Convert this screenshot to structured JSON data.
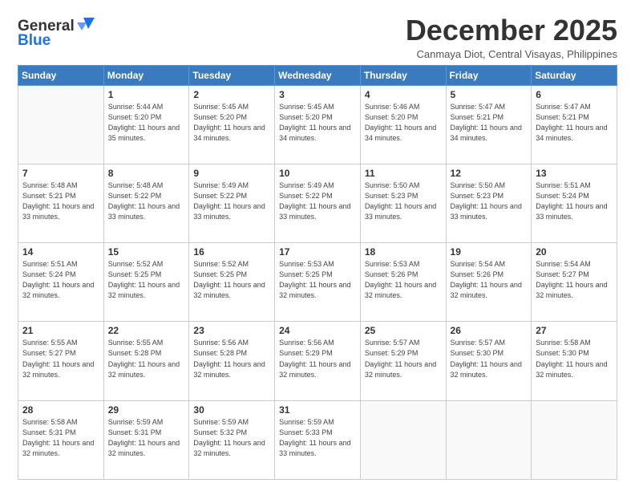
{
  "header": {
    "logo_general": "General",
    "logo_blue": "Blue",
    "month_title": "December 2025",
    "location": "Canmaya Diot, Central Visayas, Philippines"
  },
  "days_of_week": [
    "Sunday",
    "Monday",
    "Tuesday",
    "Wednesday",
    "Thursday",
    "Friday",
    "Saturday"
  ],
  "weeks": [
    [
      {
        "day": "",
        "sunrise": "",
        "sunset": "",
        "daylight": ""
      },
      {
        "day": "1",
        "sunrise": "Sunrise: 5:44 AM",
        "sunset": "Sunset: 5:20 PM",
        "daylight": "Daylight: 11 hours and 35 minutes."
      },
      {
        "day": "2",
        "sunrise": "Sunrise: 5:45 AM",
        "sunset": "Sunset: 5:20 PM",
        "daylight": "Daylight: 11 hours and 34 minutes."
      },
      {
        "day": "3",
        "sunrise": "Sunrise: 5:45 AM",
        "sunset": "Sunset: 5:20 PM",
        "daylight": "Daylight: 11 hours and 34 minutes."
      },
      {
        "day": "4",
        "sunrise": "Sunrise: 5:46 AM",
        "sunset": "Sunset: 5:20 PM",
        "daylight": "Daylight: 11 hours and 34 minutes."
      },
      {
        "day": "5",
        "sunrise": "Sunrise: 5:47 AM",
        "sunset": "Sunset: 5:21 PM",
        "daylight": "Daylight: 11 hours and 34 minutes."
      },
      {
        "day": "6",
        "sunrise": "Sunrise: 5:47 AM",
        "sunset": "Sunset: 5:21 PM",
        "daylight": "Daylight: 11 hours and 34 minutes."
      }
    ],
    [
      {
        "day": "7",
        "sunrise": "Sunrise: 5:48 AM",
        "sunset": "Sunset: 5:21 PM",
        "daylight": "Daylight: 11 hours and 33 minutes."
      },
      {
        "day": "8",
        "sunrise": "Sunrise: 5:48 AM",
        "sunset": "Sunset: 5:22 PM",
        "daylight": "Daylight: 11 hours and 33 minutes."
      },
      {
        "day": "9",
        "sunrise": "Sunrise: 5:49 AM",
        "sunset": "Sunset: 5:22 PM",
        "daylight": "Daylight: 11 hours and 33 minutes."
      },
      {
        "day": "10",
        "sunrise": "Sunrise: 5:49 AM",
        "sunset": "Sunset: 5:22 PM",
        "daylight": "Daylight: 11 hours and 33 minutes."
      },
      {
        "day": "11",
        "sunrise": "Sunrise: 5:50 AM",
        "sunset": "Sunset: 5:23 PM",
        "daylight": "Daylight: 11 hours and 33 minutes."
      },
      {
        "day": "12",
        "sunrise": "Sunrise: 5:50 AM",
        "sunset": "Sunset: 5:23 PM",
        "daylight": "Daylight: 11 hours and 33 minutes."
      },
      {
        "day": "13",
        "sunrise": "Sunrise: 5:51 AM",
        "sunset": "Sunset: 5:24 PM",
        "daylight": "Daylight: 11 hours and 33 minutes."
      }
    ],
    [
      {
        "day": "14",
        "sunrise": "Sunrise: 5:51 AM",
        "sunset": "Sunset: 5:24 PM",
        "daylight": "Daylight: 11 hours and 32 minutes."
      },
      {
        "day": "15",
        "sunrise": "Sunrise: 5:52 AM",
        "sunset": "Sunset: 5:25 PM",
        "daylight": "Daylight: 11 hours and 32 minutes."
      },
      {
        "day": "16",
        "sunrise": "Sunrise: 5:52 AM",
        "sunset": "Sunset: 5:25 PM",
        "daylight": "Daylight: 11 hours and 32 minutes."
      },
      {
        "day": "17",
        "sunrise": "Sunrise: 5:53 AM",
        "sunset": "Sunset: 5:25 PM",
        "daylight": "Daylight: 11 hours and 32 minutes."
      },
      {
        "day": "18",
        "sunrise": "Sunrise: 5:53 AM",
        "sunset": "Sunset: 5:26 PM",
        "daylight": "Daylight: 11 hours and 32 minutes."
      },
      {
        "day": "19",
        "sunrise": "Sunrise: 5:54 AM",
        "sunset": "Sunset: 5:26 PM",
        "daylight": "Daylight: 11 hours and 32 minutes."
      },
      {
        "day": "20",
        "sunrise": "Sunrise: 5:54 AM",
        "sunset": "Sunset: 5:27 PM",
        "daylight": "Daylight: 11 hours and 32 minutes."
      }
    ],
    [
      {
        "day": "21",
        "sunrise": "Sunrise: 5:55 AM",
        "sunset": "Sunset: 5:27 PM",
        "daylight": "Daylight: 11 hours and 32 minutes."
      },
      {
        "day": "22",
        "sunrise": "Sunrise: 5:55 AM",
        "sunset": "Sunset: 5:28 PM",
        "daylight": "Daylight: 11 hours and 32 minutes."
      },
      {
        "day": "23",
        "sunrise": "Sunrise: 5:56 AM",
        "sunset": "Sunset: 5:28 PM",
        "daylight": "Daylight: 11 hours and 32 minutes."
      },
      {
        "day": "24",
        "sunrise": "Sunrise: 5:56 AM",
        "sunset": "Sunset: 5:29 PM",
        "daylight": "Daylight: 11 hours and 32 minutes."
      },
      {
        "day": "25",
        "sunrise": "Sunrise: 5:57 AM",
        "sunset": "Sunset: 5:29 PM",
        "daylight": "Daylight: 11 hours and 32 minutes."
      },
      {
        "day": "26",
        "sunrise": "Sunrise: 5:57 AM",
        "sunset": "Sunset: 5:30 PM",
        "daylight": "Daylight: 11 hours and 32 minutes."
      },
      {
        "day": "27",
        "sunrise": "Sunrise: 5:58 AM",
        "sunset": "Sunset: 5:30 PM",
        "daylight": "Daylight: 11 hours and 32 minutes."
      }
    ],
    [
      {
        "day": "28",
        "sunrise": "Sunrise: 5:58 AM",
        "sunset": "Sunset: 5:31 PM",
        "daylight": "Daylight: 11 hours and 32 minutes."
      },
      {
        "day": "29",
        "sunrise": "Sunrise: 5:59 AM",
        "sunset": "Sunset: 5:31 PM",
        "daylight": "Daylight: 11 hours and 32 minutes."
      },
      {
        "day": "30",
        "sunrise": "Sunrise: 5:59 AM",
        "sunset": "Sunset: 5:32 PM",
        "daylight": "Daylight: 11 hours and 32 minutes."
      },
      {
        "day": "31",
        "sunrise": "Sunrise: 5:59 AM",
        "sunset": "Sunset: 5:33 PM",
        "daylight": "Daylight: 11 hours and 33 minutes."
      },
      {
        "day": "",
        "sunrise": "",
        "sunset": "",
        "daylight": ""
      },
      {
        "day": "",
        "sunrise": "",
        "sunset": "",
        "daylight": ""
      },
      {
        "day": "",
        "sunrise": "",
        "sunset": "",
        "daylight": ""
      }
    ]
  ]
}
